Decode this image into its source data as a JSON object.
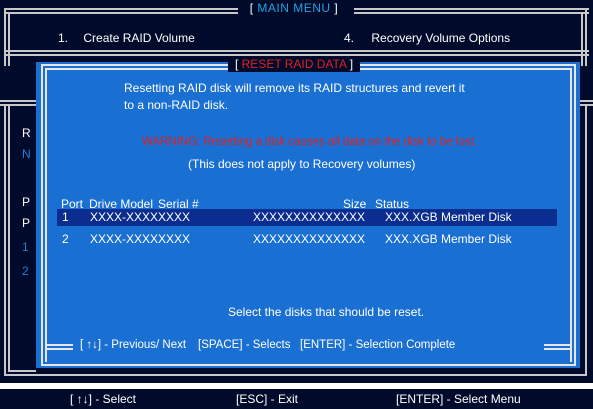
{
  "main": {
    "title_open": "[",
    "title": "MAIN MENU",
    "title_close": "]",
    "menu_items": [
      {
        "number": "1.",
        "label": "Create RAID Volume"
      },
      {
        "number": "4.",
        "label": "Recovery Volume Options"
      }
    ],
    "side_chars": [
      "R",
      "N",
      "P",
      "P",
      "1",
      "2"
    ]
  },
  "dialog": {
    "title_open": "[",
    "title": "RESET RAID DATA",
    "title_close": "]",
    "description_line1": "Resetting RAID disk will remove its RAID structures and revert it",
    "description_line2": "to a non-RAID disk.",
    "warning": "WARNING: Resetting a disk causes all data on the disk to be lost.",
    "note": "(This does not apply to Recovery volumes)",
    "columns": {
      "port": "Port",
      "model": "Drive Model",
      "serial": "Serial #",
      "size": "Size",
      "status": "Status"
    },
    "disks": [
      {
        "port": "1",
        "model": "XXXX-XXXXXXXX",
        "serial": "XXXXXXXXXXXXXX",
        "size": "XXX.XGB",
        "status": "Member Disk",
        "selected": true
      },
      {
        "port": "2",
        "model": "XXXX-XXXXXXXX",
        "serial": "XXXXXXXXXXXXXX",
        "size": "XXX.XGB",
        "status": "Member Disk",
        "selected": false
      }
    ],
    "prompt": "Select the disks that should be reset.",
    "hints": {
      "nav": "[ ↑↓] - Previous/ Next",
      "space": "[SPACE] - Selects",
      "enter": "[ENTER] - Selection Complete"
    }
  },
  "footer": {
    "select": "[ ↑↓] - Select",
    "exit": "[ESC] - Exit",
    "enter": "[ENTER] - Select Menu"
  },
  "colors": {
    "background": "#000a2a",
    "dialog": "#1a6fd2",
    "selected_row": "#0a2d8f",
    "warning": "#e02020",
    "title_accent": "#1fa3e3"
  }
}
